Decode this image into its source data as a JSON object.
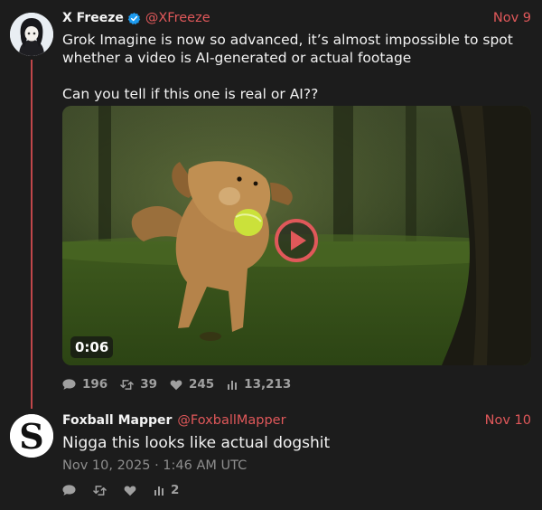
{
  "thread": {
    "tweet1": {
      "display_name": "X Freeze",
      "handle": "@XFreeze",
      "date": "Nov 9",
      "text_line1": "Grok Imagine is now so advanced, it’s almost impossible to spot whether a video is AI-generated or actual footage",
      "text_line2": "Can you tell if this one is real or AI??",
      "video": {
        "duration": "0:06"
      },
      "stats": {
        "replies": "196",
        "retweets": "39",
        "likes": "245",
        "views": "13,213"
      }
    },
    "tweet2": {
      "display_name": "Foxball Mapper",
      "handle": "@FoxballMapper",
      "date": "Nov 10",
      "text": "Nigga this looks like actual dogshit",
      "timestamp": "Nov 10, 2025 · 1:46 AM UTC",
      "stats": {
        "views": "2"
      }
    }
  },
  "colors": {
    "background": "#1c1c1c",
    "accent": "#e0585a",
    "thread_line": "#c0474a",
    "verified": "#1d9bf0",
    "muted": "#8e8e8e"
  },
  "icons": {
    "verified": "verified-badge-icon",
    "reply": "comment-icon",
    "retweet": "retweet-icon",
    "like": "heart-icon",
    "views": "bar-chart-icon",
    "play": "play-icon"
  }
}
